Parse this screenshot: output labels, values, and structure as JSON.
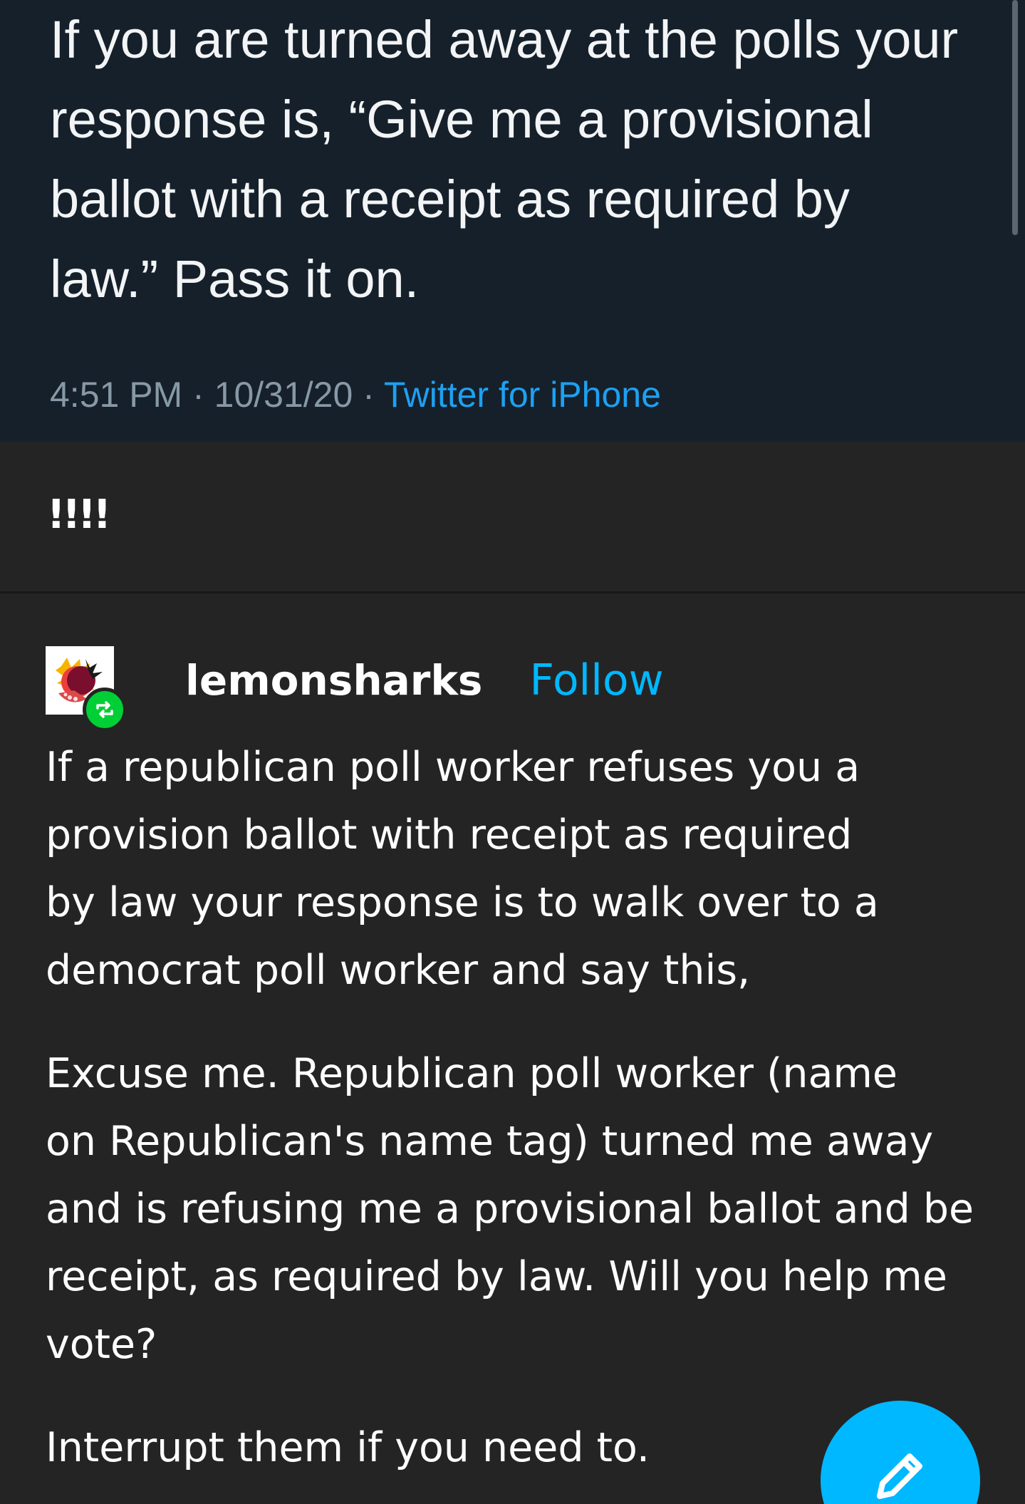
{
  "tweet": {
    "text": "If you are turned away at the polls your\nresponse is, “Give me a provisional\nballot with a receipt as required by\nlaw.” Pass it on.",
    "time": "4:51 PM",
    "date": "10/31/20",
    "separator": " · ",
    "source": "Twitter for iPhone"
  },
  "reblog_comment": "!!!!",
  "post": {
    "username": "lemonsharks",
    "follow_label": "Follow",
    "paragraphs": [
      "If a republican poll worker refuses you a\nprovision ballot with receipt as required\nby law your response is to walk over to a\ndemocrat poll worker and say this,",
      "Excuse me. Republican poll worker (name\non Republican's name tag) turned me away\nand is refusing me a provisional ballot and be\nreceipt, as required by law. Will you help me\nvote?",
      "Interrupt them if you need to."
    ]
  },
  "icons": {
    "avatar": "lemonsharks-avatar",
    "reblog": "reblog-icon",
    "compose": "pencil-icon"
  },
  "colors": {
    "background": "#242424",
    "tweet_background": "#15202b",
    "link_blue": "#00b8ff",
    "twitter_blue": "#1da1f2",
    "reblog_green": "#00cf35"
  }
}
